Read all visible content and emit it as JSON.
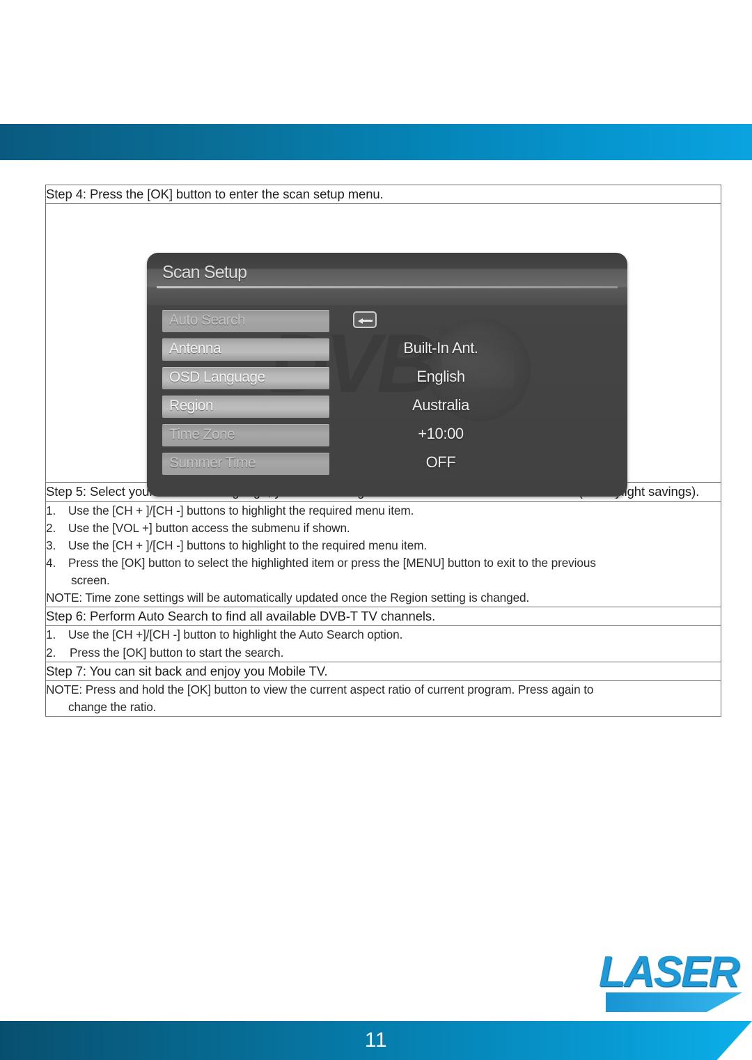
{
  "document": {
    "page_number": "11",
    "brand": "LASER"
  },
  "steps": {
    "step4": "Step 4: Press the [OK] button to enter the scan setup menu.",
    "step5_part1": "Step 5: Select your own OSD language, your current region and",
    "step5_part2": "whether it is summer time (for daylight savings).",
    "step6": "Step 6: Perform Auto Search to find all available DVB-T TV channels.",
    "step7": "Step 7: You can sit back and enjoy you Mobile TV."
  },
  "step5_list": {
    "items": [
      {
        "num": "1.",
        "text": "Use the [CH + ]/[CH -] buttons to highlight the required menu item.",
        "cont": ""
      },
      {
        "num": "2.",
        "text": "Use the [VOL +] button access the submenu if shown.",
        "cont": ""
      },
      {
        "num": "3.",
        "text": "Use the [CH + ]/[CH -] buttons to highlight to the required menu item.",
        "cont": ""
      },
      {
        "num": "4.",
        "text": "Press the [OK] button to select the highlighted item or press the [MENU] button to exit to the previous",
        "cont": "screen."
      }
    ],
    "note": "NOTE: Time zone settings will be automatically updated once the Region setting is changed."
  },
  "step6_list": {
    "items": [
      {
        "num": "1.",
        "text": "Use the [CH +]/[CH -] button to highlight the Auto Search option."
      },
      {
        "num": "2.",
        "text": "Press the [OK] button to start the search."
      }
    ]
  },
  "step7_note": {
    "text": "NOTE: Press and hold the [OK] button to view the current aspect ratio of current program. Press again to",
    "cont": "change the ratio."
  },
  "osd": {
    "title": "Scan Setup",
    "watermark": "DVB",
    "watermark_mark": "®",
    "rows": [
      {
        "label": "Auto Search",
        "value": "",
        "icon": "enter-key-icon",
        "dim": true
      },
      {
        "label": "Antenna",
        "value": "Built-In Ant.",
        "icon": "",
        "dim": false
      },
      {
        "label": "OSD Language",
        "value": "English",
        "icon": "",
        "dim": false
      },
      {
        "label": "Region",
        "value": "Australia",
        "icon": "",
        "dim": false
      },
      {
        "label": "Time Zone",
        "value": "+10:00",
        "icon": "",
        "dim": true
      },
      {
        "label": "Summer Time",
        "value": "OFF",
        "icon": "",
        "dim": true
      }
    ]
  },
  "colors": {
    "band_start": "#0a5a80",
    "band_end": "#0aa3e0",
    "brand_blue": "#1f9ad8",
    "table_border": "#6e6e6e"
  }
}
